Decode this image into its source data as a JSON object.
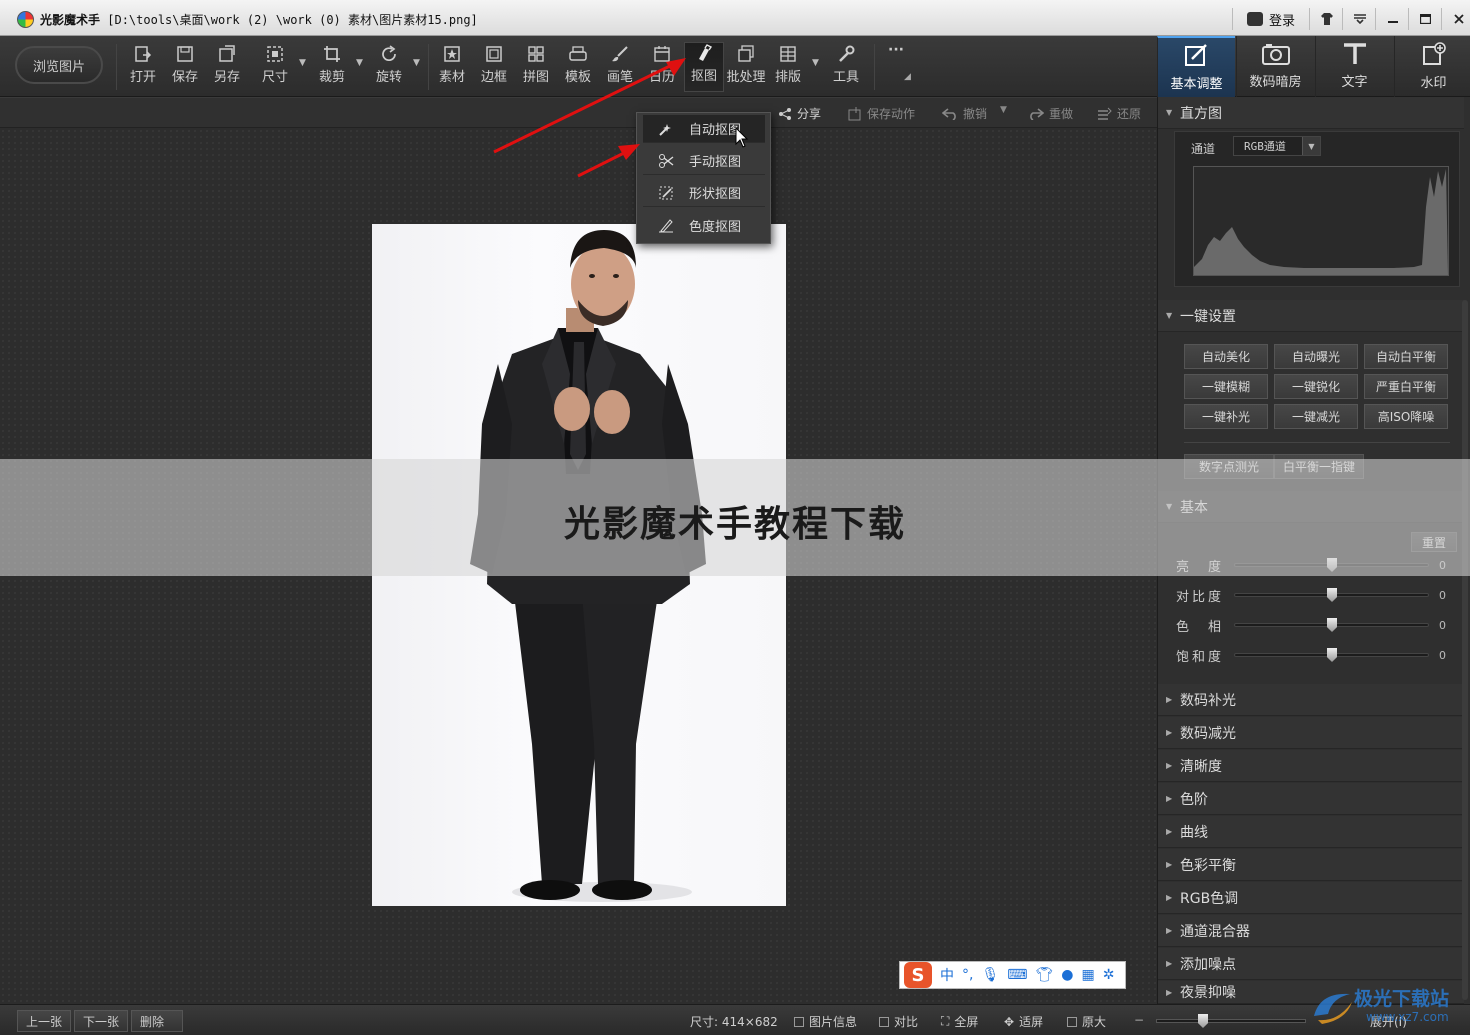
{
  "window": {
    "title_app": "光影魔术手",
    "title_path": "[D:\\tools\\桌面\\work (2) \\work (0) 素材\\图片素材15.png]",
    "login": "登录",
    "controls": [
      "shirt-icon",
      "menu-icon",
      "minimize-icon",
      "maximize-icon",
      "close-icon"
    ]
  },
  "toolbar": {
    "browse": "浏览图片",
    "tools": [
      {
        "label": "打开",
        "icon": "open-icon"
      },
      {
        "label": "保存",
        "icon": "save-icon"
      },
      {
        "label": "另存",
        "icon": "save-as-icon"
      },
      {
        "label": "尺寸",
        "icon": "resize-icon"
      },
      {
        "label": "裁剪",
        "icon": "crop-icon"
      },
      {
        "label": "旋转",
        "icon": "rotate-icon"
      },
      {
        "label": "素材",
        "icon": "material-icon"
      },
      {
        "label": "边框",
        "icon": "border-icon"
      },
      {
        "label": "拼图",
        "icon": "collage-icon"
      },
      {
        "label": "模板",
        "icon": "template-icon"
      },
      {
        "label": "画笔",
        "icon": "brush-icon"
      },
      {
        "label": "日历",
        "icon": "calendar-icon"
      },
      {
        "label": "抠图",
        "icon": "cutout-icon"
      },
      {
        "label": "批处理",
        "icon": "batch-icon"
      },
      {
        "label": "排版",
        "icon": "layout-icon"
      },
      {
        "label": "工具",
        "icon": "wrench-icon"
      }
    ],
    "more": "···"
  },
  "right_tabs": [
    {
      "label": "基本调整",
      "icon": "adjust-icon",
      "active": true
    },
    {
      "label": "数码暗房",
      "icon": "darkroom-icon",
      "active": false
    },
    {
      "label": "文字",
      "icon": "text-icon",
      "active": false
    },
    {
      "label": "水印",
      "icon": "watermark-icon",
      "active": false
    }
  ],
  "subbar": {
    "share": "分享",
    "save_action": "保存动作",
    "undo": "撤销",
    "redo": "重做",
    "restore": "还原"
  },
  "cutout_menu": {
    "items": [
      "自动抠图",
      "手动抠图",
      "形状抠图",
      "色度抠图"
    ],
    "highlighted": "自动抠图"
  },
  "panel": {
    "histogram": {
      "title": "直方图",
      "channel_label": "通道",
      "channel_value": "RGB通道"
    },
    "quick": {
      "title": "一键设置",
      "buttons": [
        "自动美化",
        "自动曝光",
        "自动白平衡",
        "一键模糊",
        "一键锐化",
        "严重白平衡",
        "一键补光",
        "一键减光",
        "高ISO降噪",
        "数字点测光",
        "白平衡一指键"
      ]
    },
    "basic": {
      "title": "基本",
      "reset": "重置",
      "sliders": [
        {
          "label": "亮　度",
          "value": "0"
        },
        {
          "label": "对比度",
          "value": "0"
        },
        {
          "label": "色　相",
          "value": "0"
        },
        {
          "label": "饱和度",
          "value": "0"
        }
      ]
    },
    "sections": [
      "数码补光",
      "数码减光",
      "清晰度",
      "色阶",
      "曲线",
      "色彩平衡",
      "RGB色调",
      "通道混合器",
      "添加噪点",
      "夜景抑噪"
    ]
  },
  "status": {
    "prev": "上一张",
    "next": "下一张",
    "delete": "删除",
    "size": "尺寸: 414×682",
    "info": "图片信息",
    "compare": "对比",
    "fullscreen": "全屏",
    "fit": "适屏",
    "original": "原大",
    "expand": "展开(I)"
  },
  "overlay": {
    "title": "光影魔术手教程下载"
  },
  "ime": {
    "logo": "S",
    "mode": "中",
    "punct": "°,"
  },
  "watermark": {
    "text": "极光下载站",
    "url": "www.xz7.com"
  },
  "colors": {
    "accent": "#4fa3f0",
    "arrow": "#e01010",
    "ime": "#e8542a"
  }
}
